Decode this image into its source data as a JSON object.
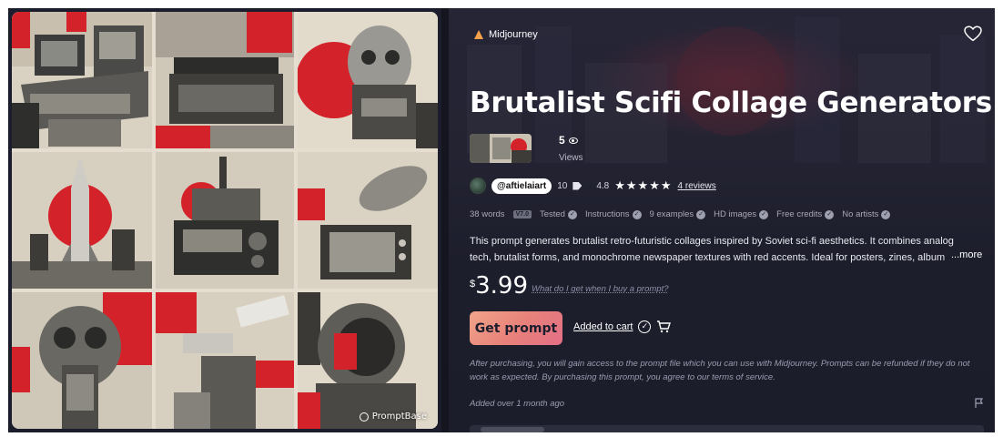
{
  "product": {
    "platform": "Midjourney",
    "title": "Brutalist Scifi Collage Generators",
    "views_count": "5",
    "views_label": "Views",
    "seller_handle": "@aftielaiart",
    "seller_count": "10",
    "rating": "4.8",
    "stars": "★★★★★",
    "reviews_link": "4 reviews",
    "word_count": "38 words",
    "version": "V7.0",
    "features": [
      "Tested",
      "Instructions",
      "9 examples",
      "HD images",
      "Free credits",
      "No artists"
    ],
    "description": "This prompt generates brutalist retro-futuristic collages inspired by Soviet sci-fi aesthetics. It combines analog tech, brutalist forms, and monochrome newspaper textures with red accents. Ideal for posters, zines, album",
    "more_label": "...more",
    "price_currency": "$",
    "price_value": "3.99",
    "price_help": "What do I get when I buy a prompt?",
    "get_prompt_label": "Get prompt",
    "added_to_cart_label": "Added to cart",
    "disclaimer": "After purchasing, you will gain access to the prompt file which you can use with Midjourney. Prompts can be refunded if they do not work as expected. By purchasing this prompt, you agree to our terms of service.",
    "added_date": "Added over 1 month ago"
  },
  "gallery": {
    "watermark": "PromptBase",
    "tiles": [
      "computer-console",
      "typewriter",
      "robot-skull",
      "rocket",
      "radio-tower",
      "satellite-tv",
      "gas-mask",
      "security-camera",
      "astronaut-helmet"
    ]
  },
  "colors": {
    "panel_bg": "#1c1d2c",
    "accent_red": "#e0262e",
    "button_gradient_start": "#f0a58a",
    "button_gradient_end": "#e36f86"
  }
}
